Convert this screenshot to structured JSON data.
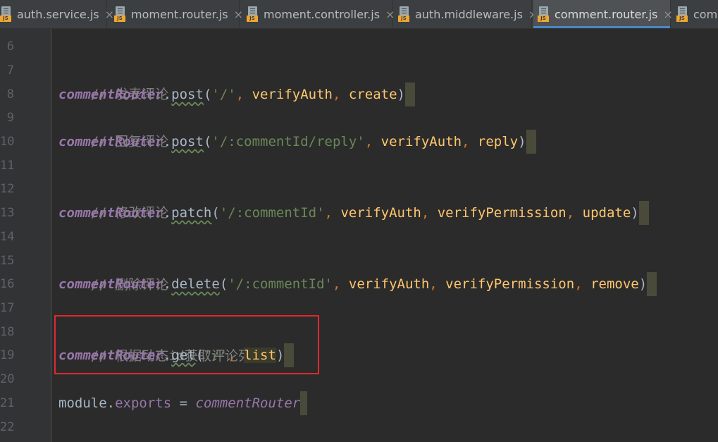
{
  "tabs": [
    {
      "label": "auth.service.js",
      "close": "×",
      "badge": "JS",
      "active": false
    },
    {
      "label": "moment.router.js",
      "close": "×",
      "badge": "JS",
      "active": false
    },
    {
      "label": "moment.controller.js",
      "close": "×",
      "badge": "JS",
      "active": false
    },
    {
      "label": "auth.middleware.js",
      "close": "×",
      "badge": "JS",
      "active": false
    },
    {
      "label": "comment.router.js",
      "close": "×",
      "badge": "JS",
      "active": true
    },
    {
      "label": "com",
      "close": "",
      "badge": "JS",
      "active": false
    }
  ],
  "gutter": {
    "line_numbers": [
      "6",
      "7",
      "8",
      "9",
      "10",
      "11",
      "12",
      "13",
      "14",
      "15",
      "16",
      "17",
      "18",
      "19",
      "20",
      "21",
      "22"
    ]
  },
  "code": {
    "l7_comment": "// 发表评论",
    "l8": {
      "obj": "commentRouter",
      "dot": ".",
      "method": "post",
      "open": "(",
      "path": "'/'",
      "sep1": ", ",
      "mw": "verifyAuth",
      "sep2": ", ",
      "handler": "create",
      "close": ")"
    },
    "l9_comment": "// 回复评论",
    "l10": {
      "obj": "commentRouter",
      "dot": ".",
      "method": "post",
      "open": "(",
      "path": "'/:commentId/reply'",
      "sep1": ", ",
      "mw": "verifyAuth",
      "sep2": ", ",
      "handler": "reply",
      "close": ")"
    },
    "l12_comment": "// 修改评论",
    "l13": {
      "obj": "commentRouter",
      "dot": ".",
      "method": "patch",
      "open": "(",
      "path": "'/:commentId'",
      "sep1": ", ",
      "mw": "verifyAuth",
      "sep2": ", ",
      "mw2": "verifyPermission",
      "sep3": ", ",
      "handler": "update",
      "close": ")"
    },
    "l15_comment": "// 删除评论",
    "l16": {
      "obj": "commentRouter",
      "dot": ".",
      "method": "delete",
      "open": "(",
      "path": "'/:commentId'",
      "sep1": ", ",
      "mw": "verifyAuth",
      "sep2": ", ",
      "mw2": "verifyPermission",
      "sep3": ", ",
      "handler": "remove",
      "close": ")"
    },
    "l18_comment": "// 根据动态id获取评论列表",
    "l19": {
      "obj": "commentRouter",
      "dot": ".",
      "method": "get",
      "open": "(",
      "path": "'/'",
      "sep1": ", ",
      "handler": "list",
      "close": ")"
    },
    "l21": {
      "module": "module",
      "dot": ".",
      "exports": "exports",
      "eq": " = ",
      "value": "commentRouter"
    }
  },
  "colors": {
    "background": "#2b2b2b",
    "comment": "#808080",
    "italic_identifier": "#9876aa",
    "string": "#6a8759",
    "function_name": "#ffc66d",
    "highlight_frame": "#e0282e"
  }
}
